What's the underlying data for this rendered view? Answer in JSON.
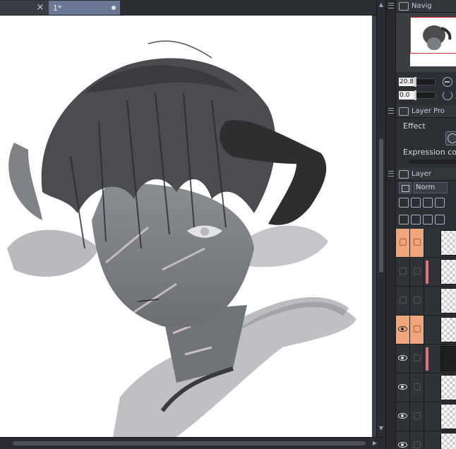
{
  "tabs": [
    {
      "label": ""
    },
    {
      "label": "1*"
    }
  ],
  "navigator": {
    "title": "Navig",
    "zoom_value": "20.8",
    "rotate_value": "0.0"
  },
  "layer_property": {
    "title": "Layer Pro",
    "effect_label": "Effect",
    "expression_label": "Expression colo"
  },
  "layer_panel": {
    "title": "Layer",
    "blend_mode": "Norm"
  },
  "layers": [
    {
      "visible": false,
      "highlight_vis": true,
      "highlight_lock": true,
      "clip": false,
      "dark": false
    },
    {
      "visible": false,
      "highlight_vis": false,
      "highlight_lock": false,
      "clip": true,
      "dark": false
    },
    {
      "visible": false,
      "highlight_vis": false,
      "highlight_lock": false,
      "clip": false,
      "dark": false
    },
    {
      "visible": true,
      "highlight_vis": true,
      "highlight_lock": true,
      "clip": false,
      "dark": false
    },
    {
      "visible": true,
      "highlight_vis": false,
      "highlight_lock": false,
      "clip": true,
      "dark": true
    },
    {
      "visible": true,
      "highlight_vis": false,
      "highlight_lock": false,
      "clip": false,
      "dark": false
    },
    {
      "visible": true,
      "highlight_vis": false,
      "highlight_lock": false,
      "clip": false,
      "dark": false
    },
    {
      "visible": true,
      "highlight_vis": false,
      "highlight_lock": false,
      "clip": false,
      "dark": false
    }
  ],
  "colors": {
    "active_tab": "#6a7895",
    "layer_highlight": "#f0a57a",
    "clip_indicator": "#e0707a",
    "navigator_frame": "#e02a2a"
  }
}
